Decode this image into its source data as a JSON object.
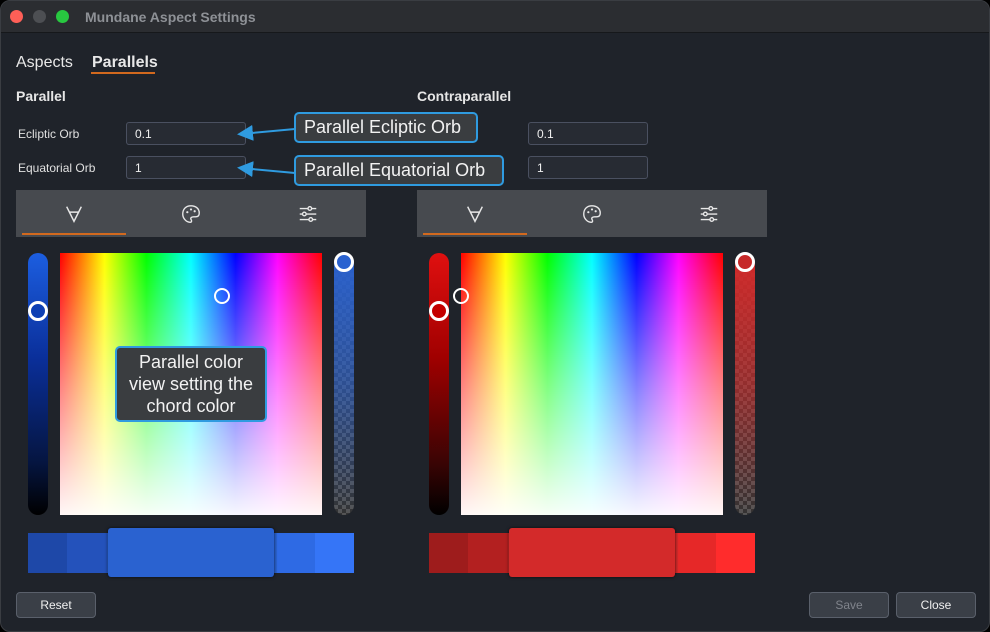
{
  "window": {
    "title": "Mundane Aspect Settings"
  },
  "tabs": [
    {
      "label": "Aspects"
    },
    {
      "label": "Parallels"
    }
  ],
  "parallel": {
    "title": "Parallel",
    "ecliptic_label": "Ecliptic Orb",
    "ecliptic_value": "0.1",
    "equatorial_label": "Equatorial Orb",
    "equatorial_value": "1",
    "color": "#2a62d0",
    "hue_position": 0.23,
    "alpha_position": 0.03
  },
  "contraparallel": {
    "title": "Contraparallel",
    "ecliptic_value": "0.1",
    "equatorial_value": "1",
    "color": "#d32a2a",
    "hue_position": 0.23,
    "alpha_position": 0.03
  },
  "toolbar_icons": [
    "eyedropper-icon",
    "palette-icon",
    "sliders-icon"
  ],
  "callouts": {
    "ecliptic": "Parallel Ecliptic Orb",
    "equatorial": "Parallel Equatorial Orb",
    "color_view": "Parallel color view setting the chord color"
  },
  "buttons": {
    "reset": "Reset",
    "save": "Save",
    "close": "Close"
  }
}
